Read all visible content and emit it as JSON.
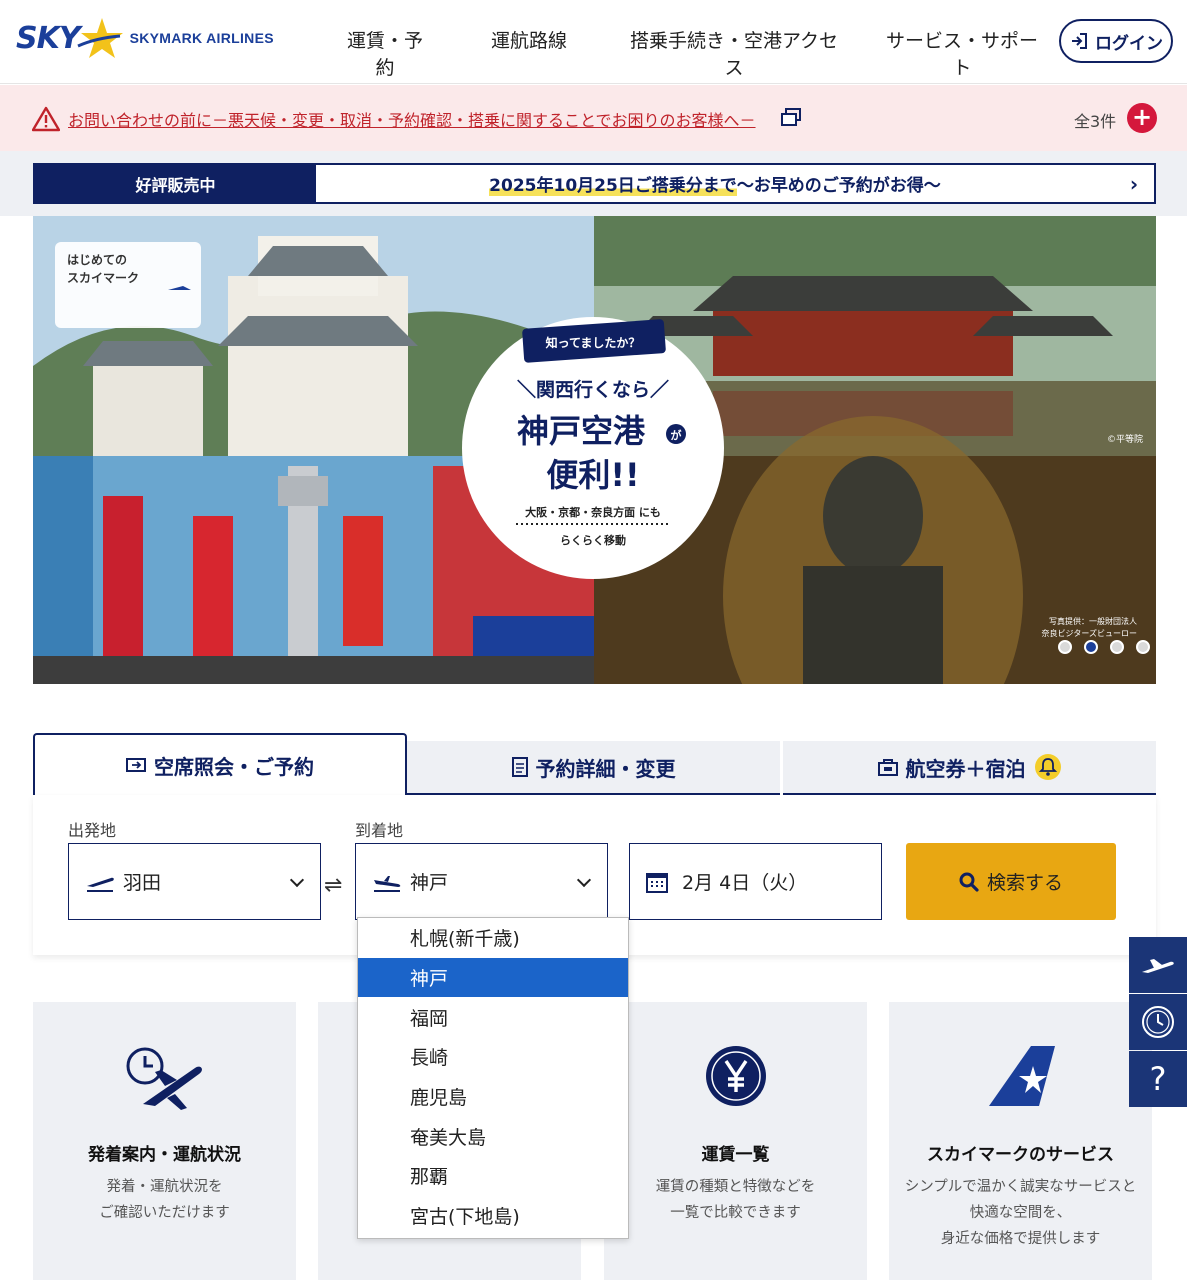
{
  "header": {
    "logo_sky": "SKY",
    "logo_text": "SKYMARK AIRLINES",
    "nav": [
      {
        "label": "運賃・予約",
        "has_menu": true
      },
      {
        "label": "運航路線",
        "has_menu": false
      },
      {
        "label": "搭乗手続き・空港アクセス",
        "has_menu": true
      },
      {
        "label": "サービス・サポート",
        "has_menu": true
      }
    ],
    "login_label": "ログイン"
  },
  "notice": {
    "text": "お問い合わせの前に－悪天候・変更・取消・予約確認・搭乗に関することでお困りのお客様へ－",
    "count": "全3件",
    "plus": "+"
  },
  "promo": {
    "tag": "好評販売中",
    "text_highlight": "2025年10月25日ご搭乗分まで",
    "text_rest": " 〜お早めのご予約がお得〜",
    "arrow": "›"
  },
  "hero": {
    "corner_line1": "はじめての",
    "corner_line2": "スカイマーク",
    "badge": "知ってましたか？",
    "line1": "＼関西行くなら／",
    "line2a": "神戸空港",
    "line2b": "が",
    "line3": "便利!!",
    "line4": "大阪・京都・奈良方面 にも",
    "line5": "らくらく移動",
    "credit1": "©平等院",
    "credit2a": "写真提供：一般財団法人",
    "credit2b": "奈良ビジターズビューロー",
    "slide_count": 4,
    "active_slide": 2
  },
  "booking": {
    "tabs": [
      {
        "label": "空席照会・ご予約",
        "icon": "ticket-icon",
        "active": true
      },
      {
        "label": "予約詳細・変更",
        "icon": "document-icon",
        "active": false
      },
      {
        "label": "航空券＋宿泊",
        "icon": "hotel-icon",
        "active": false
      }
    ],
    "origin_label": "出発地",
    "origin_value": "羽田",
    "destination_label": "到着地",
    "destination_value": "神戸",
    "swap": "⇌",
    "date_value": "2月 4日（火）",
    "search_label": "検索する"
  },
  "destination_dropdown": {
    "options": [
      "札幌(新千歳)",
      "神戸",
      "福岡",
      "長崎",
      "鹿児島",
      "奄美大島",
      "那覇",
      "宮古(下地島)"
    ],
    "selected": "神戸"
  },
  "cards": [
    {
      "title": "発着案内・運航状況",
      "desc": "発着・運航状況を\nご確認いただけます",
      "icon": "clock-plane-icon"
    },
    {
      "title": "",
      "desc": "",
      "icon": ""
    },
    {
      "title": "運賃一覧",
      "desc": "運賃の種類と特徴などを\n一覧で比較できます",
      "icon": "yen-icon"
    },
    {
      "title": "スカイマークのサービス",
      "desc": "シンプルで温かく誠実なサービスと\n快適な空間を、\n身近な価格で提供します",
      "icon": "skymark-tail-icon"
    }
  ],
  "side_buttons": [
    {
      "icon": "plane-icon"
    },
    {
      "icon": "clock-icon"
    },
    {
      "label": "?",
      "icon": "help-icon"
    }
  ],
  "colors": {
    "navy": "#0f2061",
    "brand_blue": "#1b3f9a",
    "accent_yellow": "#e8a712",
    "alert_red": "#c0232b",
    "notice_bg": "#fbe9ea",
    "selected_blue": "#1b64c9"
  }
}
